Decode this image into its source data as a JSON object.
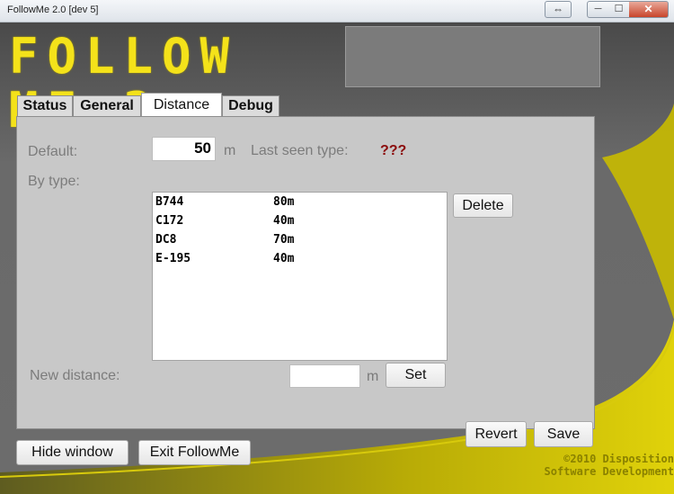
{
  "window": {
    "title": "FollowMe 2.0 [dev 5]",
    "restore_glyph": "⇔",
    "minimize_glyph": "─",
    "maximize_glyph": "☐",
    "close_glyph": "✕"
  },
  "header": {
    "logo_text": "FOLLOW ME 2"
  },
  "tabs": [
    {
      "label": "Status"
    },
    {
      "label": "General"
    },
    {
      "label": "Distance",
      "active": true
    },
    {
      "label": "Debug"
    }
  ],
  "distance": {
    "default_label": "Default:",
    "default_value": "50",
    "default_unit": "m",
    "last_seen_label": "Last seen type:",
    "last_seen_value": "???",
    "by_type_label": "By type:",
    "entries": [
      {
        "type": "B744",
        "distance": "80m"
      },
      {
        "type": "C172",
        "distance": "40m"
      },
      {
        "type": "DC8",
        "distance": "70m"
      },
      {
        "type": "E-195",
        "distance": "40m"
      }
    ],
    "delete_label": "Delete",
    "new_distance_label": "New distance:",
    "new_distance_value": "",
    "new_distance_unit": "m",
    "set_label": "Set",
    "revert_label": "Revert",
    "save_label": "Save"
  },
  "footer": {
    "hide_label": "Hide window",
    "exit_label": "Exit FollowMe",
    "copyright_line1": "©2010 Disposition",
    "copyright_line2": "Software Development"
  },
  "colors": {
    "logo": "#f4e21a",
    "accent_yellow": "#c9bb00",
    "last_seen": "#8b0b0b"
  }
}
